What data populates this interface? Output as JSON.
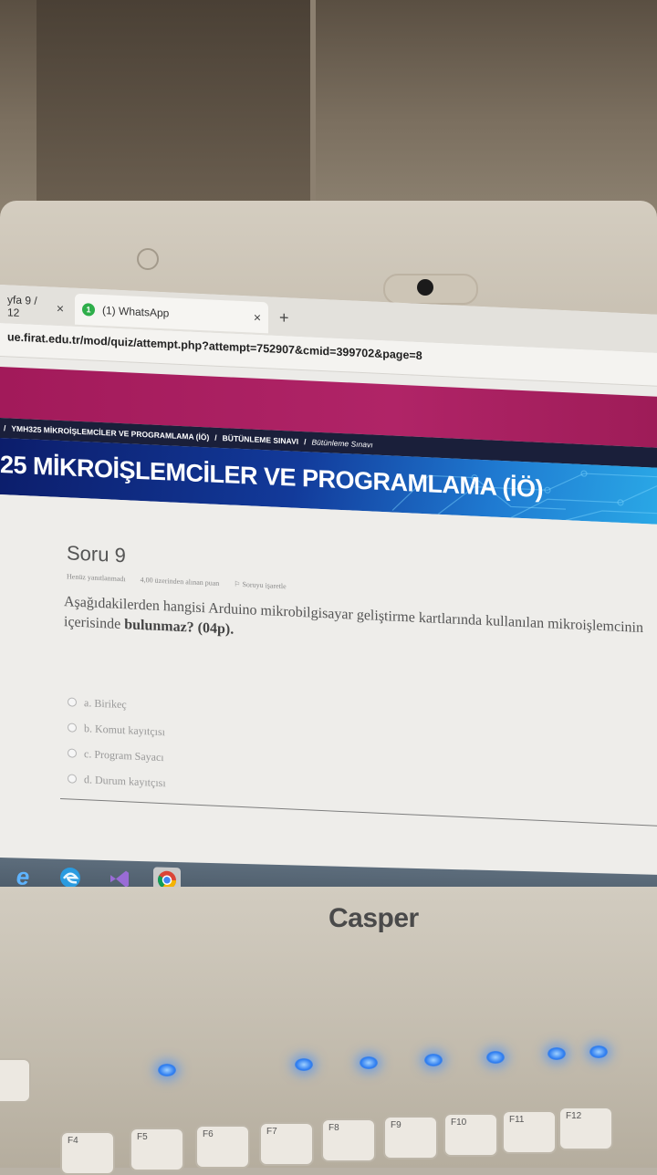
{
  "browser": {
    "tabs": [
      {
        "label": "yfa 9 / 12",
        "close": "×"
      },
      {
        "badge": "1",
        "label": "(1) WhatsApp",
        "close": "×"
      }
    ],
    "new_tab": "+",
    "url": "ue.firat.edu.tr/mod/quiz/attempt.php?attempt=752907&cmid=399702&page=8"
  },
  "breadcrumb": [
    "/",
    "YMH325 MİKROİŞLEMCİLER VE PROGRAMLAMA (İÖ)",
    "/",
    "BÜTÜNLEME SINAVI",
    "/",
    "Bütünleme Sınavı"
  ],
  "banner_title": "25 MİKROİŞLEMCİLER VE PROGRAMLAMA (İÖ)",
  "question": {
    "title": "Soru 9",
    "status": "Henüz yanıtlanmadı",
    "points": "4,00 üzerinden alınan puan",
    "flag": "Soruyu işaretle",
    "text_main": "Aşağıdakilerden hangisi Arduino mikrobilgisayar geliştirme kartlarında kullanılan mikroişlemcinin içerisinde",
    "text_bold": "bulunmaz? (04p).",
    "options": [
      "a. Birikeç",
      "b. Komut kayıtçısı",
      "c. Program Sayacı",
      "d. Durum kayıtçısı"
    ]
  },
  "taskbar": [
    "internet-explorer-icon",
    "edge-icon",
    "visual-studio-icon",
    "chrome-icon"
  ],
  "laptop": {
    "brand": "Casper",
    "fkeys": [
      "F4",
      "F5",
      "F6",
      "F7",
      "F8",
      "F9",
      "F10",
      "F11",
      "F12"
    ]
  }
}
